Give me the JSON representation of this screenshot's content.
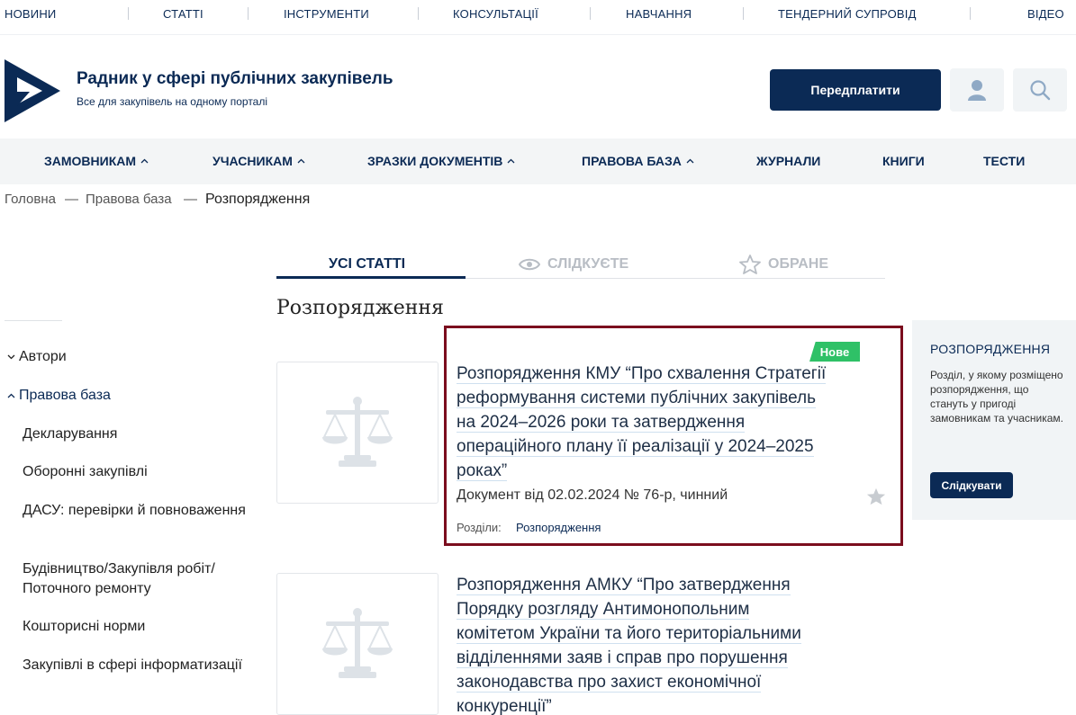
{
  "top_nav": [
    "НОВИНИ",
    "СТАТТІ",
    "ІНСТРУМЕНТИ",
    "КОНСУЛЬТАЦІЇ",
    "НАВЧАННЯ",
    "ТЕНДЕРНИЙ СУПРОВІД",
    "ВІДЕО"
  ],
  "header": {
    "title": "Радник у сфері публічних закупівель",
    "subtitle": "Все для закупівель на одному порталі",
    "subscribe_label": "Передплатити"
  },
  "icons": {
    "user": "user-icon",
    "search": "search-icon",
    "caret": "chevron-up-icon",
    "eye": "eye-icon",
    "star": "star-icon",
    "scales": "scales-icon"
  },
  "colors": {
    "brand": "#0b2a55",
    "badge": "#2fc167",
    "highlight": "#7b0d1e"
  },
  "main_menu": [
    "ЗАМОВНИКАМ",
    "УЧАСНИКАМ",
    "ЗРАЗКИ ДОКУМЕНТІВ",
    "ПРАВОВА БАЗА",
    "ЖУРНАЛИ",
    "КНИГИ",
    "ТЕСТИ"
  ],
  "breadcrumb": [
    "Головна",
    "Правова база",
    "Розпорядження"
  ],
  "breadcrumb_sep": "—",
  "tabs": [
    "УСІ СТАТТІ",
    "СЛІДКУЄТЕ",
    "ОБРАНЕ"
  ],
  "section_title": "Розпорядження",
  "sidebar": {
    "groups": [
      "Автори",
      "Правова база"
    ],
    "items": [
      "Декларування",
      "Оборонні закупівлі",
      "ДАСУ: перевірки й повноваження",
      "Будівництво/Закупівля робіт/ Поточного ремонту",
      "Кошторисні норми",
      "Закупівлі в сфері інформатизації"
    ]
  },
  "articles": [
    {
      "badge": "Нове",
      "title_lines": [
        "Розпорядження КМУ “Про схвалення Стратегії",
        "реформування системи публічних закупівель",
        "на 2024–2026 роки та затвердження",
        "операційного плану її реалізації у 2024–2025",
        "роках”"
      ],
      "meta": "Документ від 02.02.2024 № 76-р, чинний",
      "sections_label": "Розділи:",
      "sections_value": "Розпорядження"
    },
    {
      "title_lines": [
        "Розпорядження АМКУ “Про затвердження",
        "Порядку розгляду Антимонопольним",
        "комітетом України та його територіальними",
        "відділеннями заяв і справ про порушення",
        "законодавства про захист економічної",
        "конкуренції”"
      ]
    }
  ],
  "infobox": {
    "title": "РОЗПОРЯДЖЕННЯ",
    "text": "Розділ, у якому розміщено розпорядження, що стануть у пригоді замовникам та учасникам.",
    "follow_label": "Слідкувати"
  }
}
